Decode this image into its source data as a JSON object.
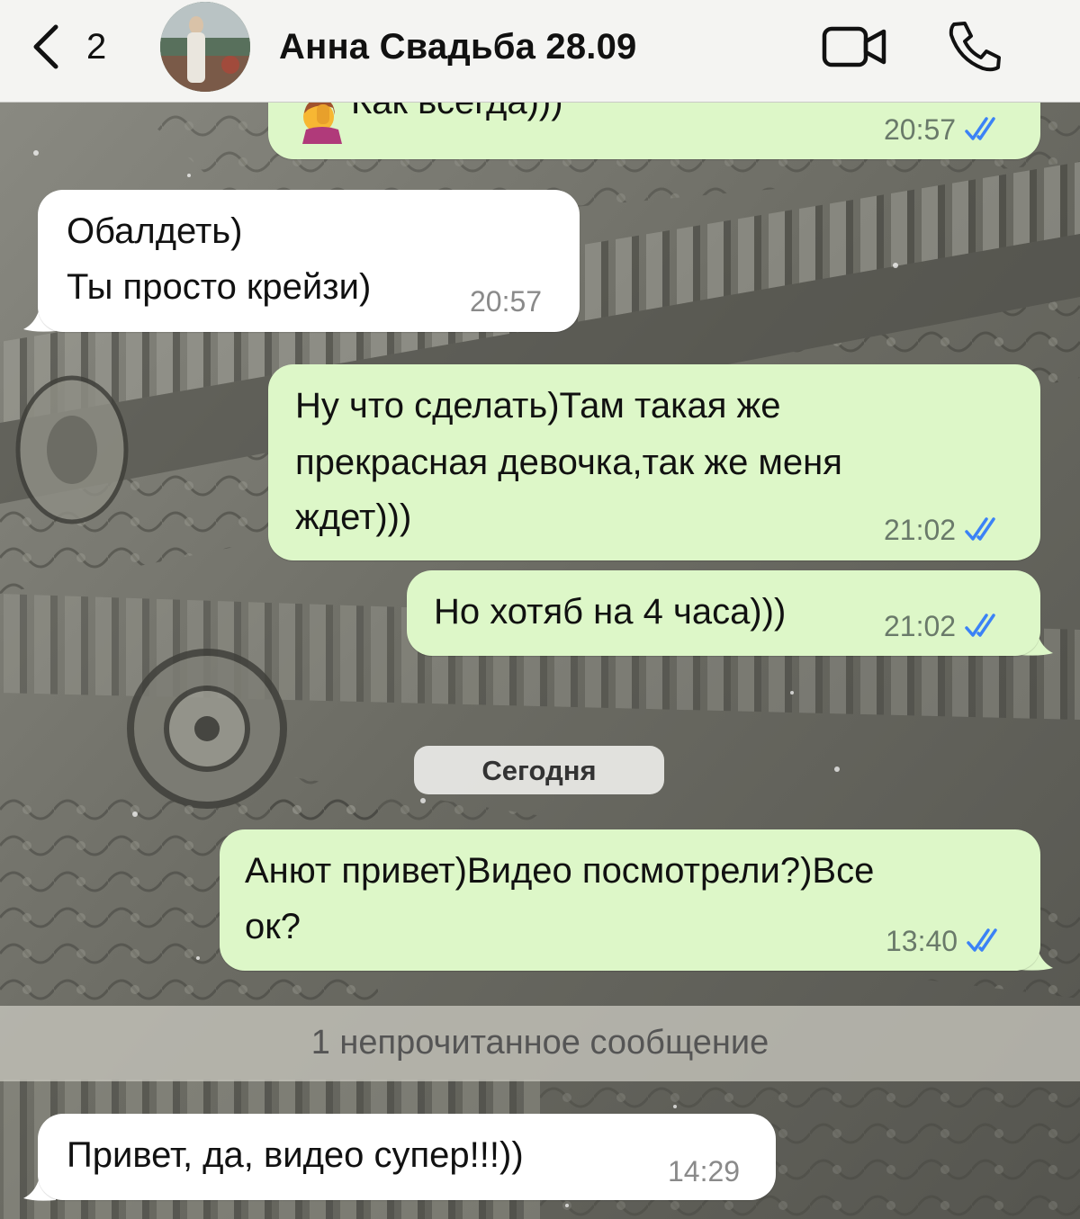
{
  "header": {
    "back_count": "2",
    "title": "Анна Свадьба 28.09",
    "back_icon": "chevron-left-icon",
    "video_icon": "video-camera-icon",
    "phone_icon": "phone-icon"
  },
  "colors": {
    "outgoing_bubble": "#ddf7c8",
    "incoming_bubble": "#ffffff",
    "read_ticks": "#3b82f6",
    "header_bg": "#f4f4f2"
  },
  "messages": [
    {
      "direction": "outgoing",
      "text": "Как всегда)))",
      "time": "20:57",
      "status": "read",
      "has_emoji": true
    },
    {
      "direction": "incoming",
      "lines": [
        "Обалдеть)",
        "Ты просто крейзи)"
      ],
      "time": "20:57"
    },
    {
      "direction": "outgoing",
      "lines": [
        "Ну что сделать)Там такая же",
        "прекрасная девочка,так же меня",
        "ждет)))"
      ],
      "time": "21:02",
      "status": "read"
    },
    {
      "direction": "outgoing",
      "text": "Но хотяб на 4 часа)))",
      "time": "21:02",
      "status": "read"
    },
    {
      "direction": "outgoing",
      "lines": [
        "Анют привет)Видео посмотрели?)Все",
        "ок?"
      ],
      "time": "13:40",
      "status": "read"
    },
    {
      "direction": "incoming",
      "text": "Привет, да, видео супер!!!))",
      "time": "14:29"
    }
  ],
  "date_separator": "Сегодня",
  "unread_banner": "1 непрочитанное сообщение"
}
